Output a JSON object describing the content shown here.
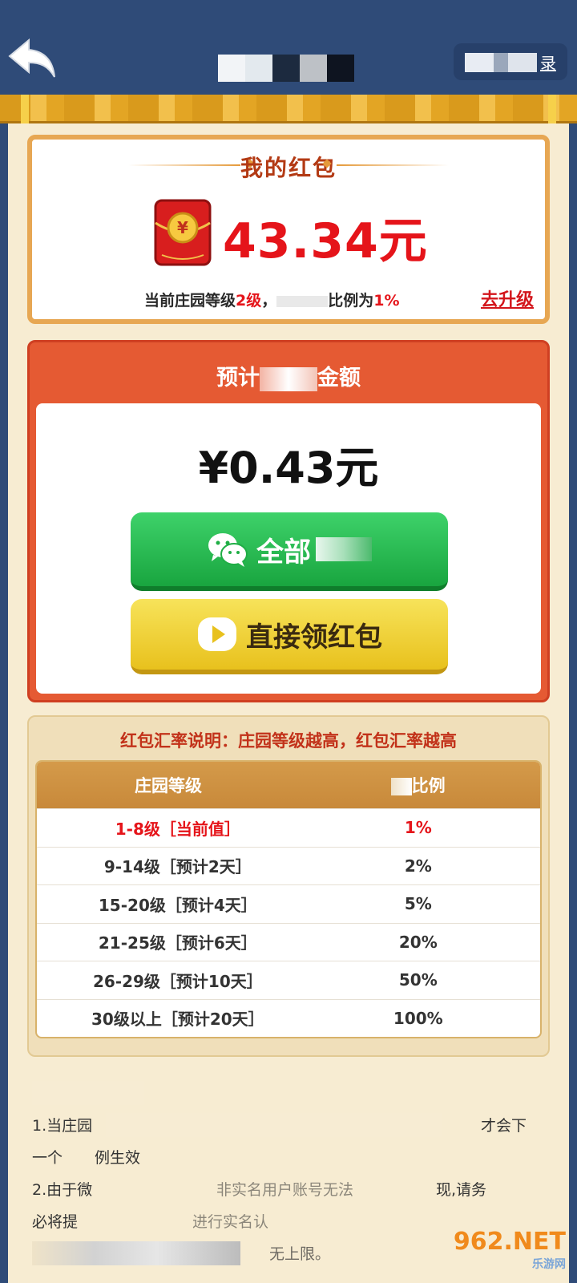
{
  "header": {
    "right_text": "录",
    "title_blur_colors": [
      "#f2f4f7",
      "#e3e9ee",
      "#1c2a3f",
      "#bdc1c6",
      "#0e1420"
    ]
  },
  "my_packet": {
    "title": "我的红包",
    "amount": "43.34元",
    "level_prefix": "当前庄园等级",
    "level_value": "2级",
    "level_mid": "，",
    "ratio_label": "比例为",
    "ratio_value": "1%",
    "upgrade_link": "去升级"
  },
  "expected": {
    "title_left": "预计",
    "title_right": "金额",
    "amount": "¥0.43元",
    "wechat_button": "全部",
    "direct_button": "直接领红包"
  },
  "rate": {
    "description": "红包汇率说明：庄园等级越高，红包汇率越高",
    "col_level": "庄园等级",
    "col_ratio": "比例",
    "rows": [
      {
        "level": "1-8级［当前值］",
        "ratio": "1%",
        "current": true
      },
      {
        "level": "9-14级［预计2天］",
        "ratio": "2%"
      },
      {
        "level": "15-20级［预计4天］",
        "ratio": "5%"
      },
      {
        "level": "21-25级［预计6天］",
        "ratio": "20%"
      },
      {
        "level": "26-29级［预计10天］",
        "ratio": "50%"
      },
      {
        "level": "30级以上［预计20天］",
        "ratio": "100%"
      }
    ]
  },
  "notes": {
    "line1": "1.当庄园",
    "line1_end": "才会下",
    "line2": "一个",
    "line2_mid": "例生效",
    "line3": "2.由于微",
    "line3_mid": "非实名用户账号无法",
    "line3_end": "现,请务",
    "line4": "必将提",
    "line4_end": "进行实名认",
    "line5_end": "无上限。"
  },
  "watermark": {
    "big": "962.NET",
    "small": "乐游网"
  }
}
